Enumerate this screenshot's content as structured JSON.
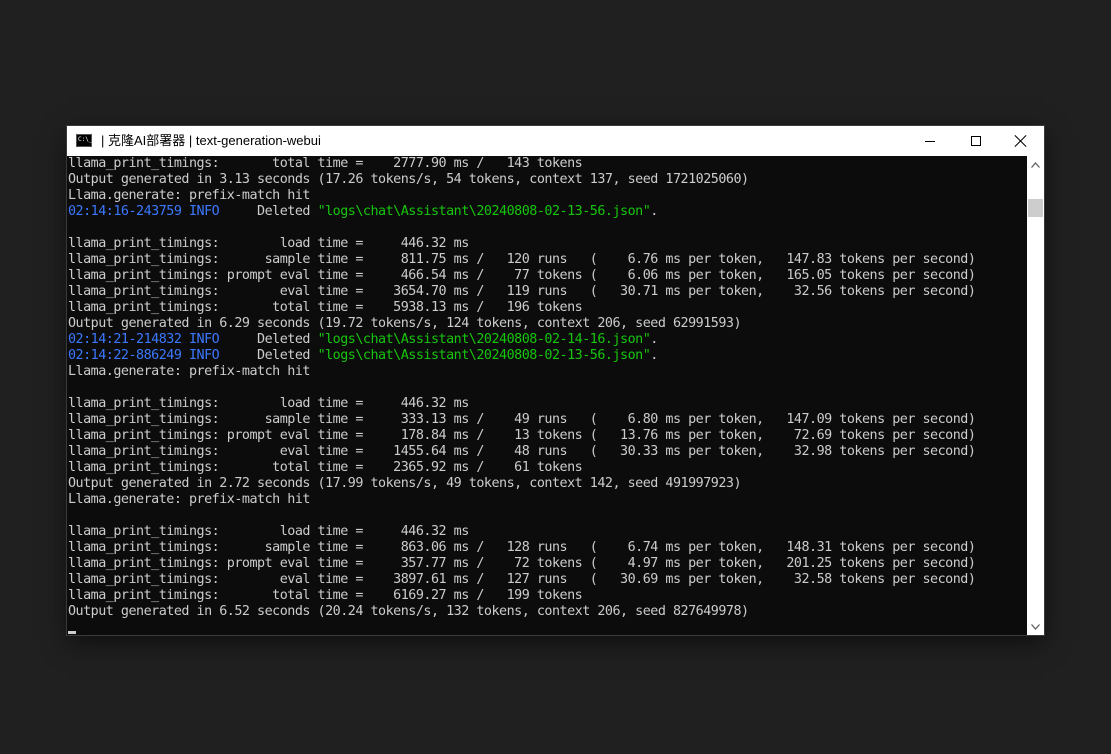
{
  "window": {
    "title": "| 克隆AI部署器 | text-generation-webui"
  },
  "scrollbar": {
    "position": 0.06,
    "visible_fraction": 0.04
  },
  "console": {
    "lines": [
      {
        "text": "llama_print_timings:       total time =    2777.90 ms /   143 tokens"
      },
      {
        "text": "Output generated in 3.13 seconds (17.26 tokens/s, 54 tokens, context 137, seed 1721025060)"
      },
      {
        "text": "Llama.generate: prefix-match hit"
      },
      {
        "ts": "02:14:16-243759",
        "level": "INFO",
        "msg": "     Deleted ",
        "path": "\"logs\\chat\\Assistant\\20240808-02-13-56.json\"",
        "tail": "."
      },
      {
        "text": ""
      },
      {
        "text": "llama_print_timings:        load time =     446.32 ms"
      },
      {
        "text": "llama_print_timings:      sample time =     811.75 ms /   120 runs   (    6.76 ms per token,   147.83 tokens per second)"
      },
      {
        "text": "llama_print_timings: prompt eval time =     466.54 ms /    77 tokens (    6.06 ms per token,   165.05 tokens per second)"
      },
      {
        "text": "llama_print_timings:        eval time =    3654.70 ms /   119 runs   (   30.71 ms per token,    32.56 tokens per second)"
      },
      {
        "text": "llama_print_timings:       total time =    5938.13 ms /   196 tokens"
      },
      {
        "text": "Output generated in 6.29 seconds (19.72 tokens/s, 124 tokens, context 206, seed 62991593)"
      },
      {
        "ts": "02:14:21-214832",
        "level": "INFO",
        "msg": "     Deleted ",
        "path": "\"logs\\chat\\Assistant\\20240808-02-14-16.json\"",
        "tail": "."
      },
      {
        "ts": "02:14:22-886249",
        "level": "INFO",
        "msg": "     Deleted ",
        "path": "\"logs\\chat\\Assistant\\20240808-02-13-56.json\"",
        "tail": "."
      },
      {
        "text": "Llama.generate: prefix-match hit"
      },
      {
        "text": ""
      },
      {
        "text": "llama_print_timings:        load time =     446.32 ms"
      },
      {
        "text": "llama_print_timings:      sample time =     333.13 ms /    49 runs   (    6.80 ms per token,   147.09 tokens per second)"
      },
      {
        "text": "llama_print_timings: prompt eval time =     178.84 ms /    13 tokens (   13.76 ms per token,    72.69 tokens per second)"
      },
      {
        "text": "llama_print_timings:        eval time =    1455.64 ms /    48 runs   (   30.33 ms per token,    32.98 tokens per second)"
      },
      {
        "text": "llama_print_timings:       total time =    2365.92 ms /    61 tokens"
      },
      {
        "text": "Output generated in 2.72 seconds (17.99 tokens/s, 49 tokens, context 142, seed 491997923)"
      },
      {
        "text": "Llama.generate: prefix-match hit"
      },
      {
        "text": ""
      },
      {
        "text": "llama_print_timings:        load time =     446.32 ms"
      },
      {
        "text": "llama_print_timings:      sample time =     863.06 ms /   128 runs   (    6.74 ms per token,   148.31 tokens per second)"
      },
      {
        "text": "llama_print_timings: prompt eval time =     357.77 ms /    72 tokens (    4.97 ms per token,   201.25 tokens per second)"
      },
      {
        "text": "llama_print_timings:        eval time =    3897.61 ms /   127 runs   (   30.69 ms per token,    32.58 tokens per second)"
      },
      {
        "text": "llama_print_timings:       total time =    6169.27 ms /   199 tokens"
      },
      {
        "text": "Output generated in 6.52 seconds (20.24 tokens/s, 132 tokens, context 206, seed 827649978)"
      }
    ]
  }
}
